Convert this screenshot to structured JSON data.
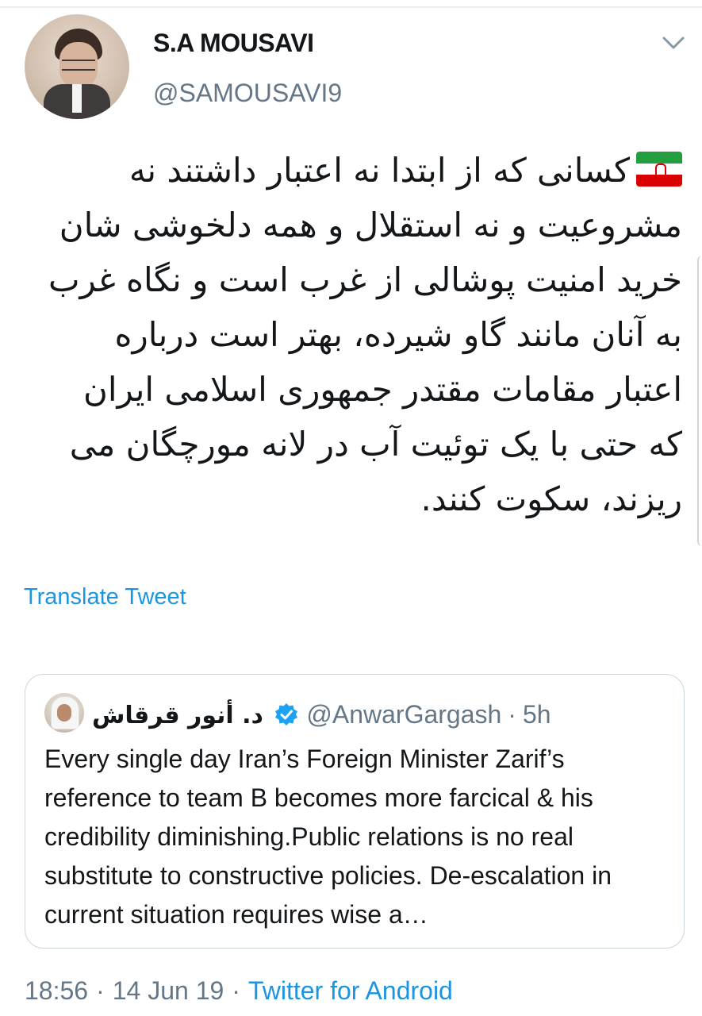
{
  "tweet": {
    "author_name": "S.A MOUSAVI",
    "author_handle": "@SAMOUSAVI9",
    "flag_icon": "iran-flag-icon",
    "text": "کسانی که از ابتدا نه اعتبار داشتند نه مشروعیت و نه استقلال و همه دلخوشی شان خرید امنیت پوشالی از غرب است و نگاه غرب به آنان مانند گاو شیرده، بهتر است درباره اعتبار مقامات مقتدر جمهوری اسلامی ایران که حتی با یک توئیت آب در لانه مورچگان می ریزند، سکوت کنند.",
    "translate_label": "Translate Tweet",
    "time": "18:56",
    "date": "14 Jun 19",
    "source": "Twitter for Android",
    "separator": "·"
  },
  "quoted": {
    "author_name": "د. أنور قرقاش",
    "author_handle": "@AnwarGargash",
    "separator": "·",
    "age": "5h",
    "text": "Every single day Iran’s Foreign Minister Zarif’s reference to team B becomes more farcical & his credibility diminishing.Public relations is no real substitute to constructive policies. De-escalation in current situation requires wise a…"
  },
  "colors": {
    "link": "#1b95e0",
    "secondary": "#657786",
    "border": "#ccd6dd",
    "verified": "#1da1f2"
  }
}
